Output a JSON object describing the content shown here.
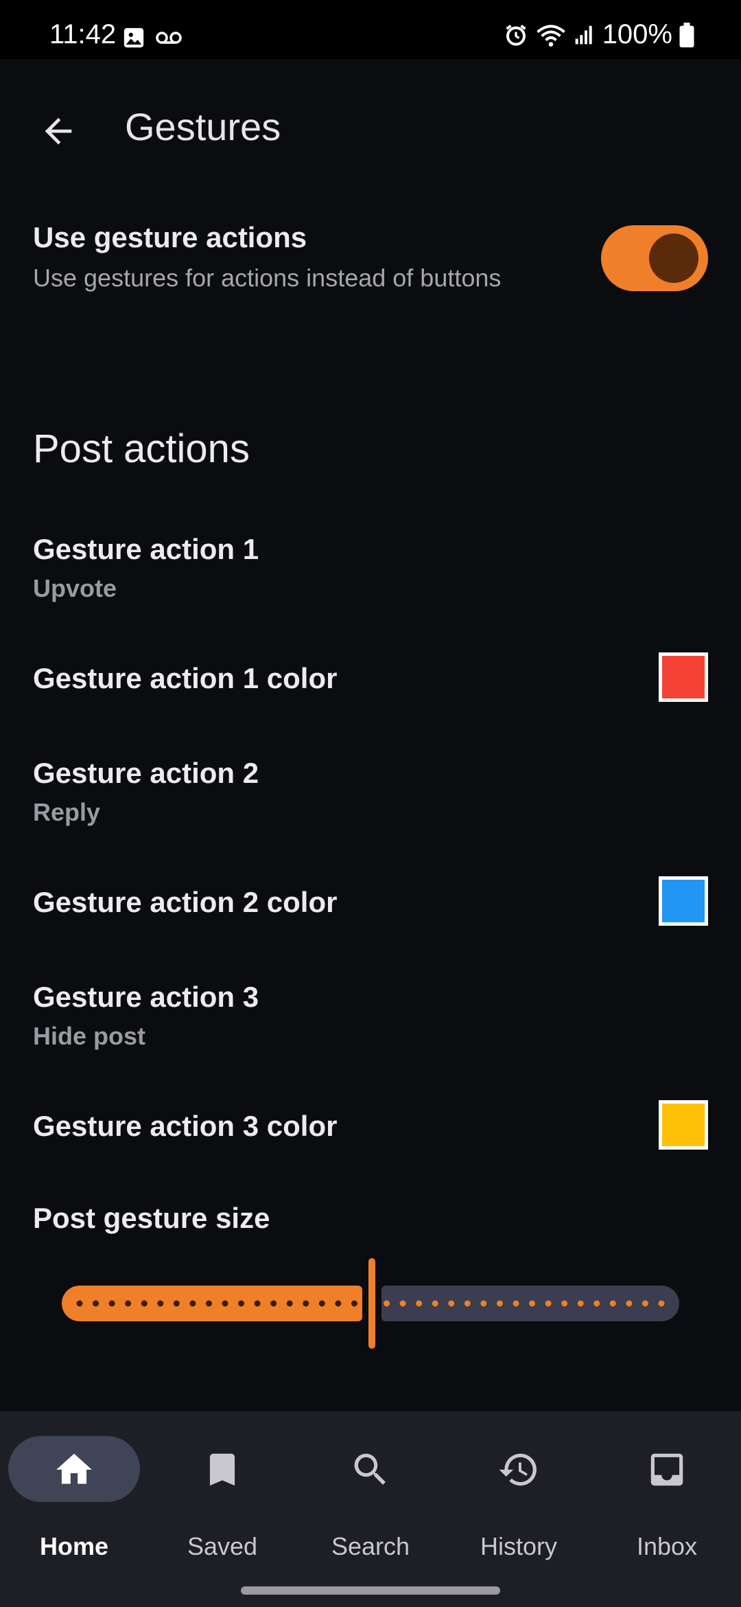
{
  "status_bar": {
    "time": "11:42",
    "battery_text": "100%",
    "left_icons": [
      "image-icon",
      "voicemail-icon"
    ],
    "right_icons": [
      "alarm-icon",
      "wifi-icon",
      "signal-icon",
      "battery-icon"
    ]
  },
  "app_bar": {
    "back_icon": "arrow-back-icon",
    "title": "Gestures"
  },
  "gesture_toggle": {
    "title": "Use gesture actions",
    "subtitle": "Use gestures for actions instead of buttons",
    "enabled": true,
    "accent_color": "#f07f2a"
  },
  "post_actions": {
    "header": "Post actions",
    "action1": {
      "title": "Gesture action 1",
      "value": "Upvote"
    },
    "action1_color": {
      "title": "Gesture action 1 color",
      "color": "#f44336"
    },
    "action2": {
      "title": "Gesture action 2",
      "value": "Reply"
    },
    "action2_color": {
      "title": "Gesture action 2 color",
      "color": "#2196f3"
    },
    "action3": {
      "title": "Gesture action 3",
      "value": "Hide post"
    },
    "action3_color": {
      "title": "Gesture action 3 color",
      "color": "#ffc107"
    },
    "gesture_size": {
      "title": "Post gesture size",
      "fraction": 0.5
    }
  },
  "bottom_nav": {
    "items": [
      {
        "label": "Home",
        "icon": "home-icon",
        "active": true
      },
      {
        "label": "Saved",
        "icon": "bookmark-icon",
        "active": false
      },
      {
        "label": "Search",
        "icon": "search-icon",
        "active": false
      },
      {
        "label": "History",
        "icon": "history-icon",
        "active": false
      },
      {
        "label": "Inbox",
        "icon": "inbox-icon",
        "active": false
      }
    ]
  }
}
